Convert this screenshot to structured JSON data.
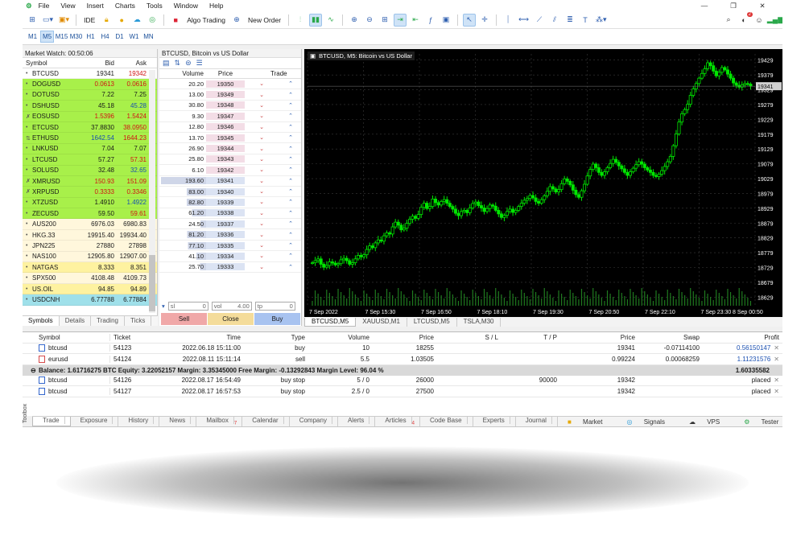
{
  "menu": {
    "items": [
      "File",
      "View",
      "Insert",
      "Charts",
      "Tools",
      "Window",
      "Help"
    ]
  },
  "toolbar": {
    "ide_label": "IDE",
    "algo_label": "Algo Trading",
    "new_order_label": "New Order",
    "notif_count": "2"
  },
  "timeframes": [
    "M1",
    "M5",
    "M15",
    "M30",
    "H1",
    "H4",
    "D1",
    "W1",
    "MN"
  ],
  "market_watch": {
    "title": "Market Watch: 00:50:06",
    "columns": {
      "symbol": "Symbol",
      "bid": "Bid",
      "ask": "Ask"
    },
    "rows": [
      {
        "symbol": "BTCUSD",
        "bid": "19341",
        "ask": "19342",
        "bg": "#ffffff",
        "marker": "•",
        "bidc": "#1a1a1a",
        "askc": "#d01414"
      },
      {
        "symbol": "DOGUSD",
        "bid": "0.0613",
        "ask": "0.0616",
        "bg": "#a8f04a",
        "marker": "•",
        "bidc": "#d01414",
        "askc": "#d01414"
      },
      {
        "symbol": "DOTUSD",
        "bid": "7.22",
        "ask": "7.25",
        "bg": "#a8f04a",
        "marker": "•",
        "bidc": "#1a1a1a",
        "askc": "#1a1a1a"
      },
      {
        "symbol": "DSHUSD",
        "bid": "45.18",
        "ask": "45.28",
        "bg": "#a8f04a",
        "marker": "•",
        "bidc": "#1a1a1a",
        "askc": "#1a4fb0"
      },
      {
        "symbol": "EOSUSD",
        "bid": "1.5396",
        "ask": "1.5424",
        "bg": "#a8f04a",
        "marker": "✗",
        "bidc": "#d01414",
        "askc": "#d01414"
      },
      {
        "symbol": "ETCUSD",
        "bid": "37.8830",
        "ask": "38.0950",
        "bg": "#a8f04a",
        "marker": "•",
        "bidc": "#1a1a1a",
        "askc": "#d01414"
      },
      {
        "symbol": "ETHUSD",
        "bid": "1642.54",
        "ask": "1644.23",
        "bg": "#a8f04a",
        "marker": "⇅",
        "bidc": "#1a4fb0",
        "askc": "#d01414"
      },
      {
        "symbol": "LNKUSD",
        "bid": "7.04",
        "ask": "7.07",
        "bg": "#a8f04a",
        "marker": "•",
        "bidc": "#1a1a1a",
        "askc": "#1a1a1a"
      },
      {
        "symbol": "LTCUSD",
        "bid": "57.27",
        "ask": "57.31",
        "bg": "#a8f04a",
        "marker": "•",
        "bidc": "#1a1a1a",
        "askc": "#d01414"
      },
      {
        "symbol": "SOLUSD",
        "bid": "32.48",
        "ask": "32.65",
        "bg": "#a8f04a",
        "marker": "•",
        "bidc": "#1a1a1a",
        "askc": "#1a4fb0"
      },
      {
        "symbol": "XMRUSD",
        "bid": "150.93",
        "ask": "151.09",
        "bg": "#a8f04a",
        "marker": "✗",
        "bidc": "#d01414",
        "askc": "#d01414"
      },
      {
        "symbol": "XRPUSD",
        "bid": "0.3333",
        "ask": "0.3346",
        "bg": "#a8f04a",
        "marker": "✗",
        "bidc": "#d01414",
        "askc": "#d01414"
      },
      {
        "symbol": "XTZUSD",
        "bid": "1.4910",
        "ask": "1.4922",
        "bg": "#a8f04a",
        "marker": "•",
        "bidc": "#1a1a1a",
        "askc": "#1a4fb0"
      },
      {
        "symbol": "ZECUSD",
        "bid": "59.50",
        "ask": "59.61",
        "bg": "#a8f04a",
        "marker": "•",
        "bidc": "#1a1a1a",
        "askc": "#d01414"
      },
      {
        "symbol": "AUS200",
        "bid": "6976.03",
        "ask": "6980.83",
        "bg": "#fff7dc",
        "marker": "•",
        "bidc": "#1a1a1a",
        "askc": "#1a1a1a"
      },
      {
        "symbol": "HKG.33",
        "bid": "19915.40",
        "ask": "19934.40",
        "bg": "#fff7dc",
        "marker": "•",
        "bidc": "#1a1a1a",
        "askc": "#1a1a1a"
      },
      {
        "symbol": "JPN225",
        "bid": "27880",
        "ask": "27898",
        "bg": "#fff7dc",
        "marker": "•",
        "bidc": "#1a1a1a",
        "askc": "#1a1a1a"
      },
      {
        "symbol": "NAS100",
        "bid": "12905.80",
        "ask": "12907.00",
        "bg": "#fff7dc",
        "marker": "•",
        "bidc": "#1a1a1a",
        "askc": "#1a1a1a"
      },
      {
        "symbol": "NATGAS",
        "bid": "8.333",
        "ask": "8.351",
        "bg": "#fef2a0",
        "marker": "•",
        "bidc": "#1a1a1a",
        "askc": "#1a1a1a"
      },
      {
        "symbol": "SPX500",
        "bid": "4108.48",
        "ask": "4109.73",
        "bg": "#fff7dc",
        "marker": "•",
        "bidc": "#1a1a1a",
        "askc": "#1a1a1a"
      },
      {
        "symbol": "US.OIL",
        "bid": "94.85",
        "ask": "94.89",
        "bg": "#fef2a0",
        "marker": "•",
        "bidc": "#1a1a1a",
        "askc": "#1a1a1a"
      },
      {
        "symbol": "USDCNH",
        "bid": "6.77788",
        "ask": "6.77884",
        "bg": "#9fe0ea",
        "marker": "•",
        "bidc": "#1a1a1a",
        "askc": "#1a1a1a"
      }
    ],
    "tabs": [
      "Symbols",
      "Details",
      "Trading",
      "Ticks"
    ]
  },
  "depth": {
    "title": "BTCUSD, Bitcoin vs US Dollar",
    "columns": {
      "volume": "Volume",
      "price": "Price",
      "trade": "Trade"
    },
    "sell": [
      {
        "vol": "20.20",
        "price": "19350"
      },
      {
        "vol": "13.00",
        "price": "19349"
      },
      {
        "vol": "30.80",
        "price": "19348"
      },
      {
        "vol": "9.30",
        "price": "19347"
      },
      {
        "vol": "12.80",
        "price": "19346"
      },
      {
        "vol": "13.70",
        "price": "19345"
      },
      {
        "vol": "26.90",
        "price": "19344"
      },
      {
        "vol": "25.80",
        "price": "19343"
      },
      {
        "vol": "6.10",
        "price": "19342"
      }
    ],
    "buy": [
      {
        "vol": "193.60",
        "price": "19341"
      },
      {
        "vol": "83.00",
        "price": "19340"
      },
      {
        "vol": "82.80",
        "price": "19339"
      },
      {
        "vol": "61.20",
        "price": "19338"
      },
      {
        "vol": "24.50",
        "price": "19337"
      },
      {
        "vol": "81.20",
        "price": "19336"
      },
      {
        "vol": "77.10",
        "price": "19335"
      },
      {
        "vol": "41.10",
        "price": "19334"
      },
      {
        "vol": "25.70",
        "price": "19333"
      }
    ],
    "sl_label": "sl",
    "sl_value": "0",
    "vol_label": "vol",
    "vol_value": "4.00",
    "tp_label": "tp",
    "tp_value": "0",
    "sell_label": "Sell",
    "close_label": "Close",
    "buy_label": "Buy"
  },
  "chart": {
    "label": "BTCUSD, M5:  Bitcoin vs US Dollar",
    "y_ticks": [
      "19429",
      "19379",
      "19329",
      "19279",
      "19229",
      "19179",
      "19129",
      "19079",
      "19029",
      "18979",
      "18929",
      "18879",
      "18829",
      "18779",
      "18729",
      "18679",
      "18629"
    ],
    "current_price": "19341",
    "x_ticks": [
      "7 Sep 2022",
      "7 Sep 15:30",
      "7 Sep 16:50",
      "7 Sep 18:10",
      "7 Sep 19:30",
      "7 Sep 20:50",
      "7 Sep 22:10",
      "7 Sep 23:30",
      "8 Sep 00:50"
    ],
    "tabs": [
      "BTCUSD,M5",
      "XAUUSD,M1",
      "LTCUSD,M5",
      "TSLA,M30"
    ],
    "colors": {
      "bg": "#000000",
      "candle": "#00e600",
      "grid": "#3a3a3a",
      "text": "#ffffff",
      "volume": "#1f7a1f"
    }
  },
  "chart_data": {
    "type": "candlestick",
    "title": "BTCUSD, M5:  Bitcoin vs US Dollar",
    "ylim": [
      18600,
      19450
    ],
    "x_tick_labels": [
      "7 Sep 2022",
      "7 Sep 15:30",
      "7 Sep 16:50",
      "7 Sep 18:10",
      "7 Sep 19:30",
      "7 Sep 20:50",
      "7 Sep 22:10",
      "7 Sep 23:30",
      "8 Sep 00:50"
    ],
    "closes": [
      18745,
      18752,
      18758,
      18740,
      18730,
      18736,
      18748,
      18744,
      18738,
      18742,
      18755,
      18760,
      18752,
      18740,
      18745,
      18758,
      18770,
      18765,
      18772,
      18790,
      18802,
      18796,
      18812,
      18822,
      18818,
      18836,
      18846,
      18842,
      18866,
      18882,
      18872,
      18856,
      18862,
      18878,
      18892,
      18902,
      18895,
      18908,
      18932,
      18946,
      18928,
      18935,
      18960,
      18948,
      18940,
      18952,
      18958,
      18946,
      18935,
      18926,
      18912,
      18904,
      18918,
      18922,
      18914,
      18930,
      18945,
      18950,
      18938,
      18930,
      18918,
      18928,
      18940,
      18936,
      18922,
      18910,
      18898,
      18905,
      18918,
      18926,
      18915,
      18922,
      18935,
      18946,
      18956,
      18962,
      18972,
      18964,
      18952,
      18946,
      18958,
      18971,
      18986,
      19002,
      18994,
      18984,
      18992,
      19012,
      19028,
      19020,
      19008,
      18990,
      18975,
      18966,
      18988,
      19010,
      19038,
      19060,
      19078,
      19066,
      19050,
      19040,
      19052,
      19066,
      19080,
      19094,
      19084,
      19072,
      19062,
      19050,
      19040,
      19052,
      19064,
      19076,
      19086,
      19078,
      19066,
      19058,
      19050,
      19040,
      19036,
      19044,
      19056,
      19070,
      19086,
      19104,
      19140,
      19180,
      19220,
      19248,
      19262,
      19280,
      19310,
      19332,
      19350,
      19368,
      19384,
      19400,
      19420,
      19410,
      19392,
      19376,
      19388,
      19404,
      19396,
      19382,
      19368,
      19352,
      19344,
      19338,
      19345,
      19350,
      19348,
      19341
    ]
  },
  "trade": {
    "columns": [
      "Symbol",
      "Ticket",
      "Time",
      "Type",
      "Volume",
      "Price",
      "S / L",
      "T / P",
      "Price",
      "Swap",
      "Profit"
    ],
    "positions": [
      {
        "symbol": "btcusd",
        "ticket": "54123",
        "time": "2022.06.18 15:11:00",
        "type": "buy",
        "volume": "10",
        "price": "18255",
        "sl": "",
        "tp": "",
        "cur": "19341",
        "swap": "-0.07114100",
        "profit": "0.56150147",
        "side": "buy"
      },
      {
        "symbol": "eurusd",
        "ticket": "54124",
        "time": "2022.08.11 15:11:14",
        "type": "sell",
        "volume": "5.5",
        "price": "1.03505",
        "sl": "",
        "tp": "",
        "cur": "0.99224",
        "swap": "0.00068259",
        "profit": "1.11231576",
        "side": "sell"
      }
    ],
    "balance_line": "Balance: 1.61716275 BTC  Equity: 3.22052157  Margin: 3.35345000  Free Margin: -0.13292843  Margin Level: 96.04 %",
    "balance_profit": "1.60335582",
    "orders": [
      {
        "symbol": "btcusd",
        "ticket": "54126",
        "time": "2022.08.17 16:54:49",
        "type": "buy stop",
        "volume": "5 / 0",
        "price": "26000",
        "sl": "",
        "tp": "90000",
        "cur": "19342",
        "swap": "",
        "profit": "placed"
      },
      {
        "symbol": "btcusd",
        "ticket": "54127",
        "time": "2022.08.17 16:57:53",
        "type": "buy stop",
        "volume": "2.5 / 0",
        "price": "27500",
        "sl": "",
        "tp": "",
        "cur": "19342",
        "swap": "",
        "profit": "placed"
      }
    ]
  },
  "bottom_tabs": {
    "toolbox_label": "Toolbox",
    "items": [
      {
        "label": "Trade",
        "badge": ""
      },
      {
        "label": "Exposure",
        "badge": ""
      },
      {
        "label": "History",
        "badge": ""
      },
      {
        "label": "News",
        "badge": ""
      },
      {
        "label": "Mailbox",
        "badge": "7"
      },
      {
        "label": "Calendar",
        "badge": ""
      },
      {
        "label": "Company",
        "badge": ""
      },
      {
        "label": "Alerts",
        "badge": ""
      },
      {
        "label": "Articles",
        "badge": "4"
      },
      {
        "label": "Code Base",
        "badge": ""
      },
      {
        "label": "Experts",
        "badge": ""
      },
      {
        "label": "Journal",
        "badge": ""
      }
    ],
    "right": [
      "Market",
      "Signals",
      "VPS",
      "Tester"
    ]
  }
}
